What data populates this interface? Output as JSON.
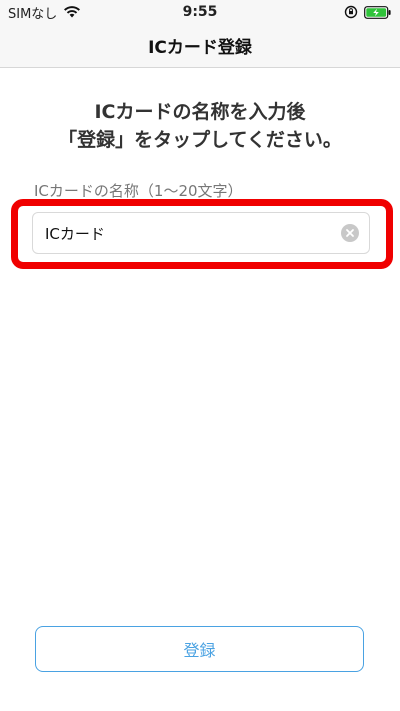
{
  "status_bar": {
    "carrier": "SIMなし",
    "time": "9:55",
    "icons": [
      "wifi-icon",
      "rotation-lock-icon",
      "battery-charging-icon"
    ],
    "battery_color": "#2fc33a"
  },
  "navbar": {
    "title": "ICカード登録"
  },
  "instruction": {
    "line1": "ICカードの名称を入力後",
    "line2": "「登録」をタップしてください。"
  },
  "field": {
    "label": "ICカードの名称（1〜20文字）",
    "value": "ICカード",
    "clear_icon": "clear-icon"
  },
  "highlight": {
    "color": "#f00000"
  },
  "register": {
    "label": "登録",
    "color": "#4aa2e2"
  }
}
